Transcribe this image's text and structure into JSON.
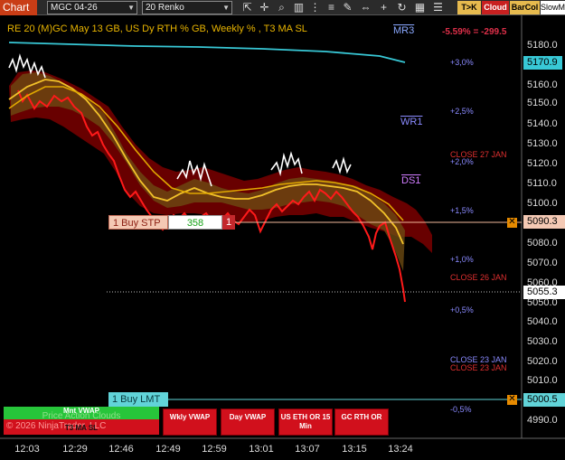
{
  "toolbar": {
    "tab_label": "Chart",
    "instrument": "MGC 04-26",
    "bar_type": "20 Renko",
    "icons": [
      "pointer-icon",
      "crosshair-icon",
      "zoom-icon",
      "bars-icon",
      "properties-icon",
      "lines-icon",
      "pencil-icon",
      "move-icon",
      "plus-icon"
    ],
    "badge_tk": "T>K",
    "badge_cloud": "Cloud",
    "badge_barcol": "BarCol",
    "badge_slow": "SlowM"
  },
  "chart": {
    "title": "RE 20  (M)GC May 13 GB, US Dy RTH % GB, Weekly % , T3 MA SL",
    "pnl": "-5.59% = -299.5",
    "level_labels": {
      "mr3": "MR3",
      "wr1": "WR1",
      "ds1": "DS1"
    },
    "pct_labels": [
      "+3,0%",
      "+2,5%",
      "+2,0%",
      "+1,5%",
      "+1,0%",
      "+0,5%",
      "-0,5%"
    ],
    "close_labels": [
      "CLOSE 27 JAN",
      "CLOSE 26 JAN",
      "CLOSE 23 JAN",
      "CLOSE 23 JAN"
    ],
    "colors": {
      "cyan_line": "#38c8d6",
      "renko_up": "#ffffff",
      "renko_down": "#ff1a1a",
      "t3_ma": "#f2c22a",
      "cloud": "#8a0000",
      "accent_orange": "#e68a00"
    }
  },
  "orders": {
    "buy_stop_label": "1 Buy STP",
    "buy_stop_qty": "358",
    "buy_stop_count": "1",
    "buy_stop_price": "5090.3",
    "buy_limit_label": "1 Buy LMT",
    "buy_limit_price": "5000.5"
  },
  "price_axis": {
    "ticks": [
      "5180.0",
      "5160.0",
      "5150.0",
      "5140.0",
      "5130.0",
      "5120.0",
      "5110.0",
      "5100.0",
      "5080.0",
      "5070.0",
      "5060.0",
      "5050.0",
      "5040.0",
      "5030.0",
      "5020.0",
      "5010.0",
      "4990.0"
    ],
    "current_price": "5170.9",
    "last_price": "5055.3"
  },
  "time_axis": [
    "12:03",
    "12:29",
    "12:46",
    "12:49",
    "12:59",
    "13:01",
    "13:07",
    "13:15",
    "13:24"
  ],
  "indicator_panel": {
    "mini_vwap": "Mnt VWAP",
    "price_action_clouds": "Price Action Clouds",
    "t3_ma_sl": "T3 MA SL",
    "copyright": "© 2026 NinjaTrader, LLC",
    "buttons": [
      "Wkly VWAP",
      "Day VWAP",
      "US ETH OR 15 Min",
      "GC RTH OR"
    ]
  }
}
